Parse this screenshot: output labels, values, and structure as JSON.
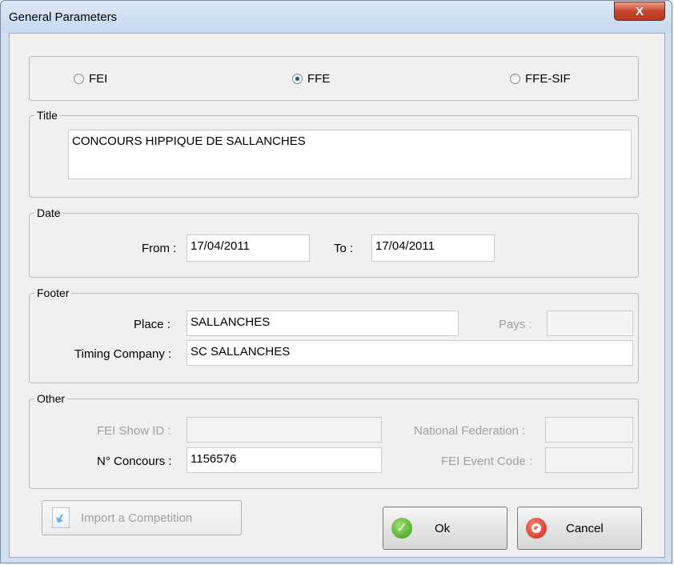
{
  "window": {
    "title": "General Parameters",
    "close_label": "X"
  },
  "federation": {
    "options": [
      {
        "label": "FEI",
        "checked": false
      },
      {
        "label": "FFE",
        "checked": true
      },
      {
        "label": "FFE-SIF",
        "checked": false
      }
    ]
  },
  "title_group": {
    "legend": "Title",
    "value": "CONCOURS HIPPIQUE DE SALLANCHES"
  },
  "date_group": {
    "legend": "Date",
    "from_label": "From :",
    "from_value": "17/04/2011",
    "to_label": "To :",
    "to_value": "17/04/2011"
  },
  "footer_group": {
    "legend": "Footer",
    "place_label": "Place :",
    "place_value": "SALLANCHES",
    "pays_label": "Pays :",
    "pays_value": "",
    "timing_label": "Timing Company :",
    "timing_value": "SC SALLANCHES"
  },
  "other_group": {
    "legend": "Other",
    "fei_show_id_label": "FEI Show ID :",
    "fei_show_id_value": "",
    "national_federation_label": "National Federation :",
    "national_federation_value": "",
    "concours_label": "N° Concours :",
    "concours_value": "1156576",
    "fei_event_code_label": "FEI Event Code :",
    "fei_event_code_value": ""
  },
  "buttons": {
    "import_label": "Import a Competition",
    "ok_label": "Ok",
    "cancel_label": "Cancel"
  }
}
